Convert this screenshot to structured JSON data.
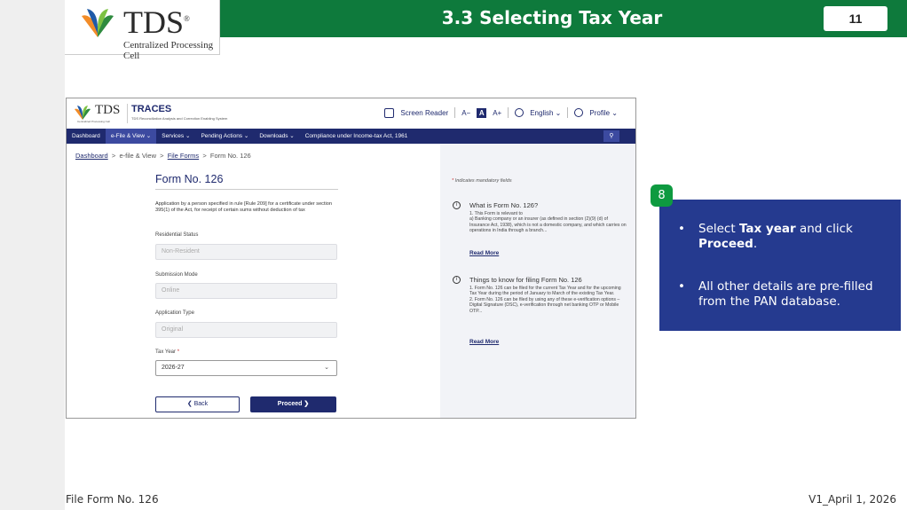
{
  "slide": {
    "title": "3.3 Selecting Tax Year",
    "page_number": "11",
    "logo_text": "TDS",
    "logo_reg": "®",
    "logo_subtitle": "Centralized Processing Cell",
    "footer_left": "File Form No. 126",
    "footer_right": "V1_April 1, 2026"
  },
  "site": {
    "logo_text": "TDS",
    "logo_sub": "Centralized Processing Cell",
    "traces_title": "TRACES",
    "traces_sub": "TDS Reconciliation Analysis and Correction Enabling System",
    "screen_reader": "Screen Reader",
    "font_decrease": "A−",
    "font_normal": "A",
    "font_increase": "A+",
    "language": "English ⌄",
    "profile": "Profile ⌄"
  },
  "nav": {
    "items": [
      "Dashboard",
      "e-File & View ⌄",
      "Services ⌄",
      "Pending Actions ⌄",
      "Downloads ⌄",
      "Compliance under Income-tax Act, 1961"
    ],
    "search_icon": "search-icon"
  },
  "breadcrumb": {
    "dashboard": "Dashboard",
    "sep": ">",
    "efile": "e-file & View",
    "file_forms": "File Forms",
    "current": "Form No. 126"
  },
  "form": {
    "title": "Form No. 126",
    "description": "Application by a person specified in rule [Rule 209] for a certificate under section 395(1) of the Act, for receipt of certain sums without deduction of tax",
    "residential_status_label": "Residential Status",
    "residential_status_value": "Non-Resident",
    "submission_mode_label": "Submission Mode",
    "submission_mode_value": "Online",
    "application_type_label": "Application Type",
    "application_type_value": "Original",
    "tax_year_label": "Tax Year",
    "required_marker": "*",
    "tax_year_value": "2026-27",
    "back_button": "❮  Back",
    "proceed_button": "Proceed  ❯"
  },
  "info": {
    "mandatory_note": "Indicates mandatory fields",
    "section1_title": "What is Form No. 126?",
    "section1_text": "1. This Form is relevant to\n    a) Banking company or an insurer (as defined in section (2)(9) (d) of Insurance Act, 1938), which is not a domestic company, and which carries on operations in India through a branch...",
    "section2_title": "Things to know for filing Form No. 126",
    "section2_text": "1. Form No. 126 can be filed for the current Tax Year and for the upcoming Tax Year during the period of January to March of the existing Tax Year.\n2. Form No. 126 can be filed by using any of these e-verification options – Digital Signature (DSC), e-verification through net banking OTP or Mobile OTP...",
    "read_more": "Read More"
  },
  "callout": {
    "badge": "8",
    "bullet_char": "•",
    "b1_part1": "Select ",
    "b1_bold1": "Tax year",
    "b1_part2": " and click ",
    "b1_bold2": "Proceed",
    "b1_part3": ".",
    "b2": "All other details are pre-filled from the PAN database."
  }
}
